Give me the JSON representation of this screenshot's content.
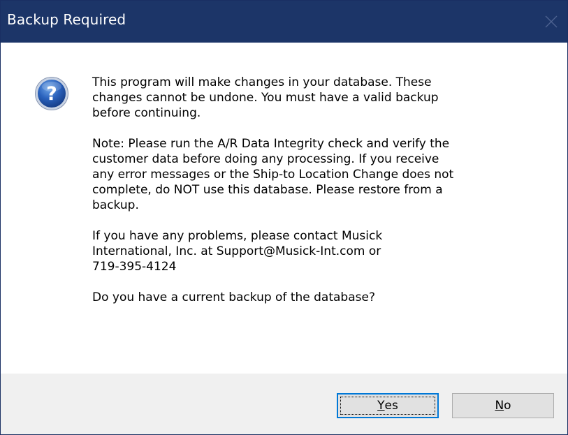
{
  "window": {
    "title": "Backup Required",
    "close_icon": "close-icon"
  },
  "dialog": {
    "icon": "question-icon",
    "paragraphs": [
      "This program will make changes in your database.  These\nchanges cannot be undone. You must have a valid backup\nbefore continuing.",
      "Note: Please run the A/R Data Integrity check and verify the\ncustomer data before doing any processing.  If you receive\nany error messages or the Ship-to Location Change does not\ncomplete, do NOT use this database. Please restore from a\nbackup.",
      "If you have any problems, please contact Musick\nInternational, Inc. at Support@Musick-Int.com or\n719-395-4124",
      "Do you have a current backup of the database?"
    ]
  },
  "buttons": {
    "yes": {
      "mnemonic": "Y",
      "rest": "es"
    },
    "no": {
      "mnemonic": "N",
      "rest": "o"
    }
  },
  "colors": {
    "titlebar": "#1c3568",
    "footer": "#f0f0f0",
    "focus_border": "#0078d7"
  }
}
